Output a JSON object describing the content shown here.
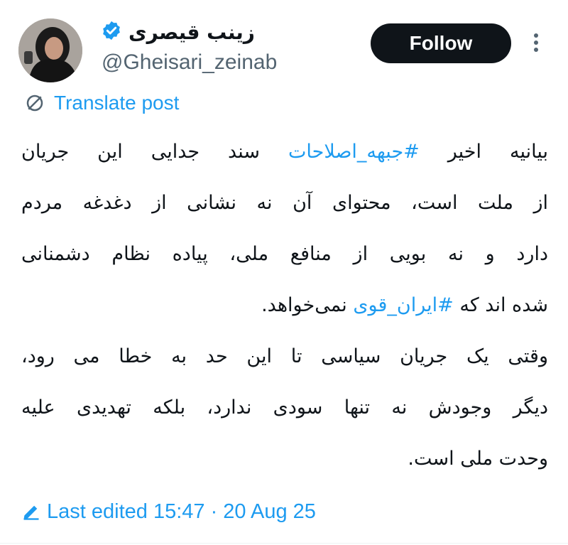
{
  "author": {
    "display_name": "زینب قیصری",
    "username": "@Gheisari_zeinab",
    "verified_color": "#1d9bf0"
  },
  "follow_button": {
    "label": "Follow"
  },
  "more_button": {
    "icon": "more-vertical-icon"
  },
  "translate": {
    "label": "Translate post",
    "icon": "translate-globe-icon"
  },
  "tweet": {
    "lines": [
      {
        "segments": [
          {
            "text": "بیانیه اخیر ",
            "hashtag": false
          },
          {
            "text": "#جبهه_اصلاحات",
            "hashtag": true
          },
          {
            "text": " سند جدایی این جریان",
            "hashtag": false
          }
        ]
      },
      {
        "segments": [
          {
            "text": "از ملت است، محتوای آن نه نشانی از دغدغه مردم",
            "hashtag": false
          }
        ]
      },
      {
        "segments": [
          {
            "text": "دارد و نه بویی از منافع ملی، پیاده نظام دشمنانی",
            "hashtag": false
          }
        ]
      },
      {
        "segments": [
          {
            "text": "شده اند که ",
            "hashtag": false
          },
          {
            "text": "#ایران_قوی",
            "hashtag": true
          },
          {
            "text": " نمی‌خواهد.",
            "hashtag": false
          }
        ],
        "last": true
      },
      {
        "segments": [
          {
            "text": "وقتی یک جریان سیاسی تا این حد به خطا می رود،",
            "hashtag": false
          }
        ]
      },
      {
        "segments": [
          {
            "text": "دیگر وجودش نه تنها سودی ندارد، بلکه تهدیدی علیه",
            "hashtag": false
          }
        ]
      },
      {
        "segments": [
          {
            "text": "وحدت ملی است.",
            "hashtag": false
          }
        ],
        "last": true
      }
    ]
  },
  "edited": {
    "label": "Last edited 15:47 · 20 Aug 25",
    "icon": "pencil-icon"
  },
  "colors": {
    "link": "#1d9bf0",
    "text": "#0f1419",
    "muted": "#536471",
    "button_bg": "#0f1419"
  }
}
